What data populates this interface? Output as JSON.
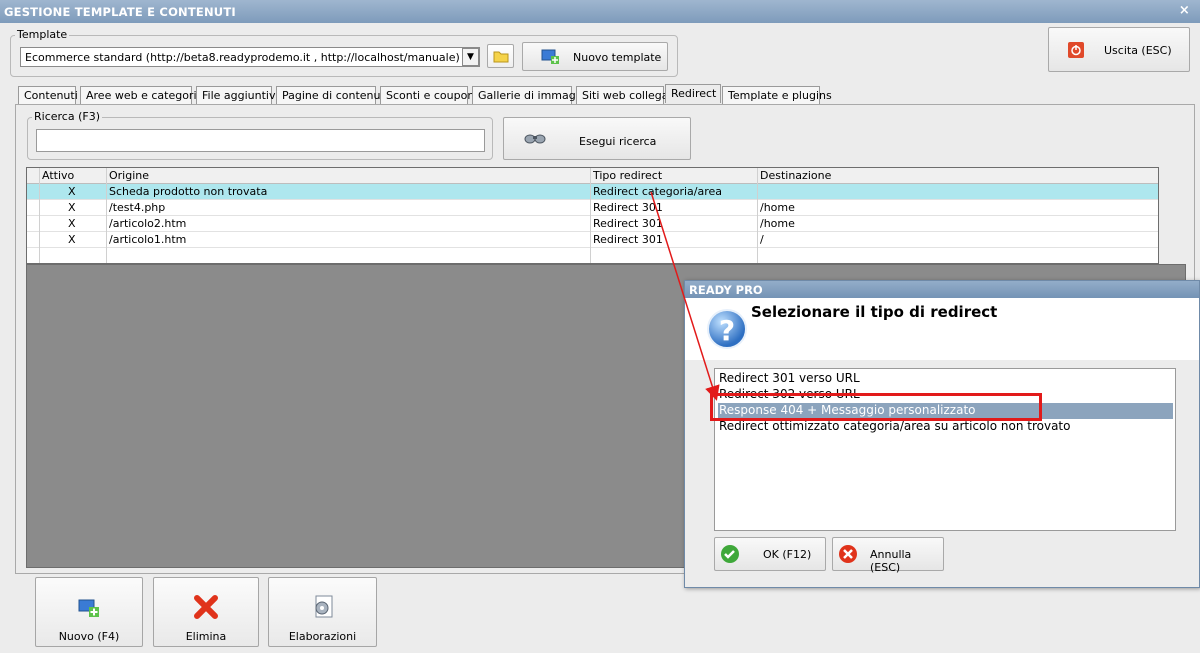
{
  "window": {
    "title": "GESTIONE TEMPLATE E CONTENUTI",
    "close_glyph": "×"
  },
  "template_group": {
    "label": "Template",
    "selected": "Ecommerce standard (http://beta8.readyprodemo.it , http://localhost/manuale)",
    "arrow_glyph": "▼",
    "new_template_label": "Nuovo template"
  },
  "exit_button": {
    "label": "Uscita (ESC)"
  },
  "tabs": [
    {
      "label": "Contenuti"
    },
    {
      "label": "Aree web e categorie"
    },
    {
      "label": "File aggiuntivi"
    },
    {
      "label": "Pagine di contenuti"
    },
    {
      "label": "Sconti e coupon"
    },
    {
      "label": "Gallerie di immagini"
    },
    {
      "label": "Siti web collegati"
    },
    {
      "label": "Redirect"
    },
    {
      "label": "Template e plugins"
    }
  ],
  "active_tab": "Redirect",
  "search": {
    "label": "Ricerca (F3)",
    "value": "",
    "button_label": "Esegui ricerca"
  },
  "grid": {
    "columns": [
      "Attivo",
      "Origine",
      "Tipo redirect",
      "Destinazione"
    ],
    "rows": [
      {
        "attivo": "X",
        "origine": "Scheda prodotto non trovata",
        "tipo": "Redirect categoria/area",
        "destinazione": ""
      },
      {
        "attivo": "X",
        "origine": "/test4.php",
        "tipo": "Redirect 301",
        "destinazione": "/home"
      },
      {
        "attivo": "X",
        "origine": "/articolo2.htm",
        "tipo": "Redirect 301",
        "destinazione": "/home"
      },
      {
        "attivo": "X",
        "origine": "/articolo1.htm",
        "tipo": "Redirect 301",
        "destinazione": "/"
      }
    ],
    "selected_row": 0
  },
  "bottom_buttons": [
    {
      "label": "Nuovo (F4)"
    },
    {
      "label": "Elimina"
    },
    {
      "label": "Elaborazioni"
    }
  ],
  "dialog": {
    "title": "READY PRO",
    "message": "Selezionare il tipo di redirect",
    "question_glyph": "?",
    "options": [
      "Redirect 301 verso URL",
      "Redirect 302 verso URL",
      "Response 404 + Messaggio personalizzato",
      "Redirect ottimizzato categoria/area su articolo non trovato"
    ],
    "selected_option": 2,
    "ok_label": "OK (F12)",
    "cancel_label": "Annulla (ESC)"
  },
  "colors": {
    "selected_row": "#aee7ee",
    "list_selection": "#8ca4bd",
    "highlight_box": "#e21a1a",
    "arrow": "#e21a1a"
  }
}
